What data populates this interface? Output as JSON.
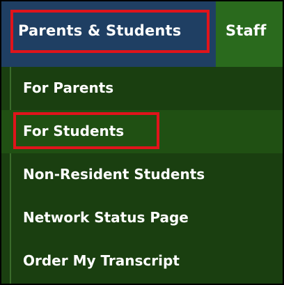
{
  "nav": {
    "tabs": [
      {
        "label": "Parents & Students",
        "active": true
      },
      {
        "label": "Staff",
        "active": false
      }
    ]
  },
  "dropdown": {
    "items": [
      {
        "label": "For Parents"
      },
      {
        "label": "For Students",
        "hovered": true
      },
      {
        "label": "Non-Resident Students"
      },
      {
        "label": "Network Status Page"
      },
      {
        "label": "Order My Transcript"
      }
    ]
  },
  "colors": {
    "nav_bar": "#2a6a1d",
    "active_tab": "#1f3f63",
    "dropdown_bg": "#1a3f10",
    "hover_bg": "#205013",
    "highlight_box": "#e0141b"
  }
}
